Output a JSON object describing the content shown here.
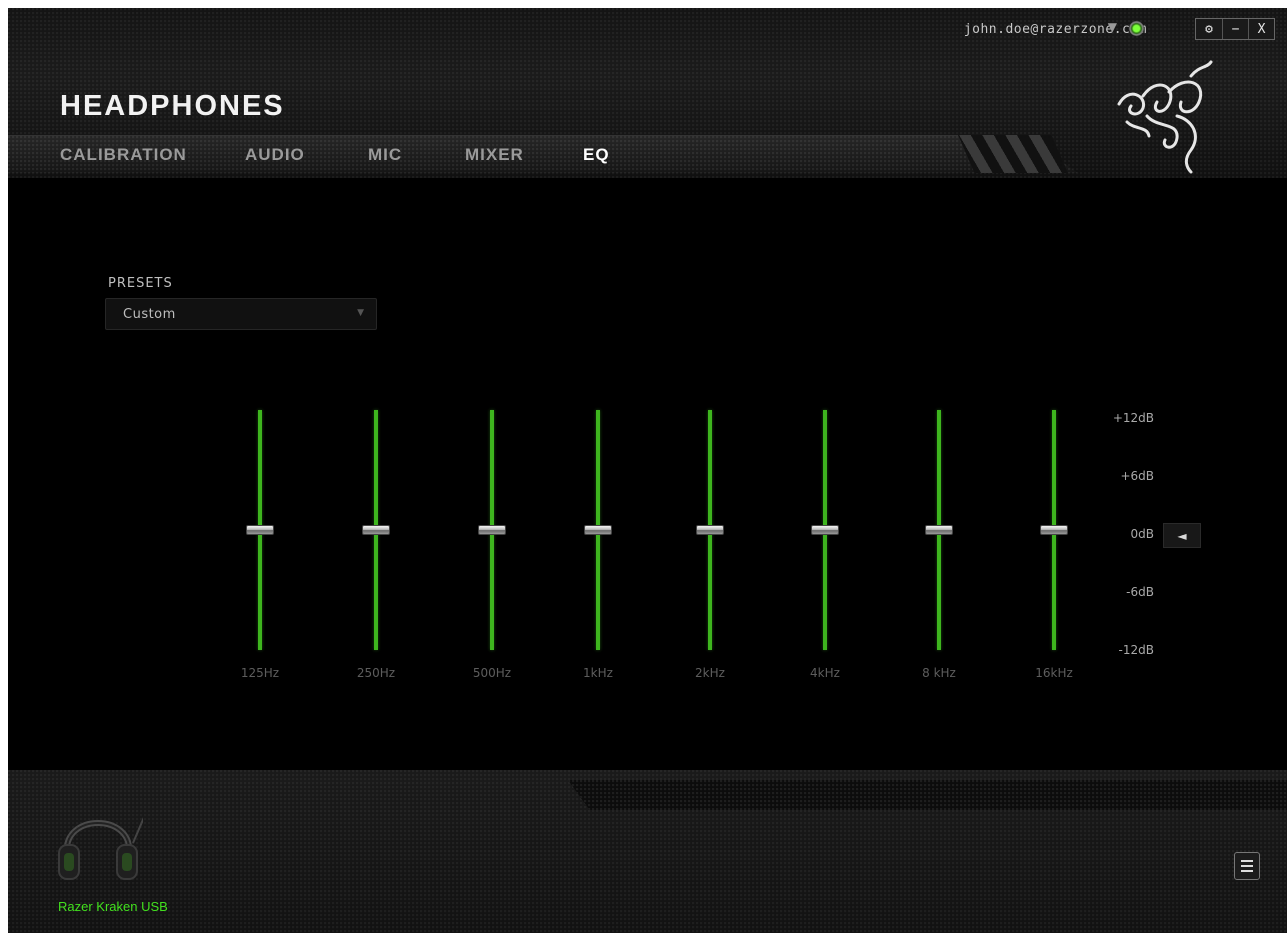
{
  "header": {
    "account_email": "john.doe@razerzone.com",
    "account_caret": "▼",
    "window_controls": {
      "settings": "⚙",
      "minimize": "−",
      "close": "X"
    },
    "title": "HEADPHONES"
  },
  "tabs": [
    {
      "label": "CALIBRATION",
      "active": false
    },
    {
      "label": "AUDIO",
      "active": false
    },
    {
      "label": "MIC",
      "active": false
    },
    {
      "label": "MIXER",
      "active": false
    },
    {
      "label": "EQ",
      "active": true
    }
  ],
  "presets": {
    "label": "PRESETS",
    "value": "Custom",
    "caret": "▼"
  },
  "eq": {
    "db_range": [
      -12,
      12
    ],
    "bands": [
      {
        "label": "125Hz",
        "gain_db": 0
      },
      {
        "label": "250Hz",
        "gain_db": 0
      },
      {
        "label": "500Hz",
        "gain_db": 0
      },
      {
        "label": "1kHz",
        "gain_db": 0
      },
      {
        "label": "2kHz",
        "gain_db": 0
      },
      {
        "label": "4kHz",
        "gain_db": 0
      },
      {
        "label": "8 kHz",
        "gain_db": 0
      },
      {
        "label": "16kHz",
        "gain_db": 0
      }
    ],
    "db_labels": [
      "+12dB",
      "+6dB",
      "0dB",
      "-6dB",
      "-12dB"
    ],
    "reset_icon": "◄",
    "accent_color": "#3eb51e"
  },
  "footer": {
    "device_name": "Razer Kraken USB",
    "device_name_color": "#42e01e"
  }
}
